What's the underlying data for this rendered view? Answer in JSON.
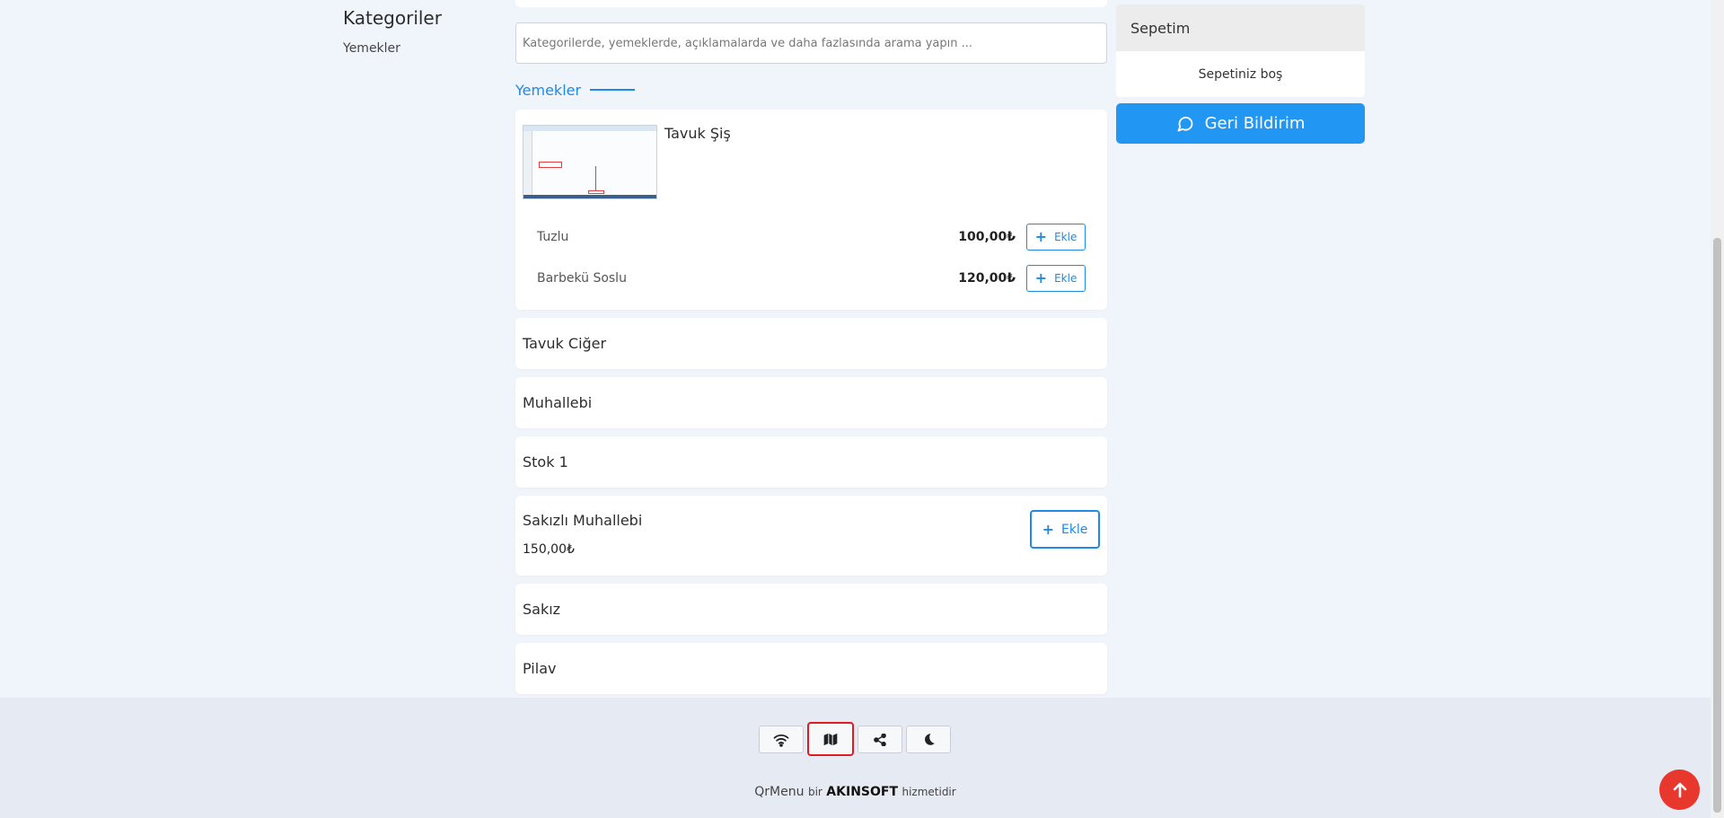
{
  "sidebar": {
    "title": "Kategoriler",
    "categories": [
      "Yemekler"
    ]
  },
  "search": {
    "placeholder": "Kategorilerde, yemeklerde, açıklamalarda ve daha fazlasında arama yapın ..."
  },
  "section": {
    "title": "Yemekler"
  },
  "products": {
    "expanded": {
      "name": "Tavuk Şiş",
      "variants": [
        {
          "name": "Tuzlu",
          "price": "100,00₺",
          "add_label": "Ekle"
        },
        {
          "name": "Barbekü Soslu",
          "price": "120,00₺",
          "add_label": "Ekle"
        }
      ]
    },
    "simple": [
      "Tavuk Ciğer",
      "Muhallebi",
      "Stok 1"
    ],
    "priced": {
      "name": "Sakızlı Muhallebi",
      "price": "150,00₺",
      "add_label": "Ekle"
    },
    "simple2": [
      "Sakız",
      "Pilav"
    ]
  },
  "cart": {
    "title": "Sepetim",
    "empty_text": "Sepetiniz boş",
    "feedback_label": "Geri Bildirim"
  },
  "footer": {
    "tools": [
      "wifi-icon",
      "map-icon",
      "share-icon",
      "moon-icon"
    ],
    "credit": {
      "product": "QrMenu",
      "mid": "bir",
      "brand": "AKINSOFT",
      "suffix": "hizmetidir"
    }
  },
  "colors": {
    "accent": "#2196f3",
    "danger": "#e8382e"
  }
}
